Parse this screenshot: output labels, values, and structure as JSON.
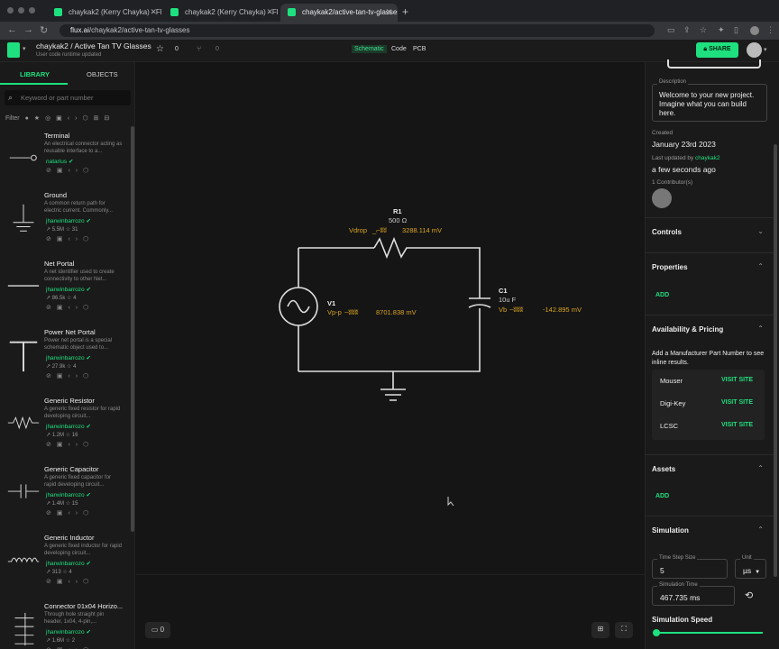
{
  "browser": {
    "tabs": [
      {
        "label": "chaykak2 (Kerry Chayka) - Flux"
      },
      {
        "label": "chaykak2 (Kerry Chayka) - Flux"
      },
      {
        "label": "chaykak2/active-tan-tv-glasses"
      }
    ],
    "url_host": "flux.ai",
    "url_path": "/chaykak2/active-tan-tv-glasses"
  },
  "header": {
    "title": "chaykak2 / Active Tan TV Glasses",
    "subtitle": "User code runtime updated",
    "star_count": "0",
    "fork_count": "0",
    "modes": [
      "Schematic",
      "Code",
      "PCB"
    ],
    "share_label": "SHARE"
  },
  "left": {
    "tabs": [
      "LIBRARY",
      "OBJECTS"
    ],
    "search_placeholder": "Keyword or part number",
    "filter_label": "Filter",
    "items": [
      {
        "title": "Terminal",
        "desc": "An electrical connector acting as reusable interface to a...",
        "author": "natarius",
        "stats": ""
      },
      {
        "title": "Ground",
        "desc": "A common return path for electric current. Commonly...",
        "author": "jharwinbarrozo",
        "stats": "5.5M  ☆ 31"
      },
      {
        "title": "Net Portal",
        "desc": "A net identifier used to create connectivity to other Net...",
        "author": "jharwinbarrozo",
        "stats": "86.5k  ☆ 4"
      },
      {
        "title": "Power Net Portal",
        "desc": "Power net portal is a special schematic object used to...",
        "author": "jharwinbarrozo",
        "stats": "27.9k  ☆ 4"
      },
      {
        "title": "Generic Resistor",
        "desc": "A generic fixed resistor for rapid developing circuit...",
        "author": "jharwinbarrozo",
        "stats": "1.2M  ☆ 16"
      },
      {
        "title": "Generic Capacitor",
        "desc": "A generic fixed capacitor for rapid developing circuit...",
        "author": "jharwinbarrozo",
        "stats": "1.4M  ☆ 15"
      },
      {
        "title": "Generic Inductor",
        "desc": "A generic fixed inductor for rapid developing circuit...",
        "author": "jharwinbarrozo",
        "stats": "313  ☆ 4"
      },
      {
        "title": "Connector 01x04 Horizo...",
        "desc": "Through hole straight pin header, 1x04, 4-pin,...",
        "author": "jharwinbarrozo",
        "stats": "1.6M  ☆ 2"
      }
    ]
  },
  "schematic": {
    "r1_name": "R1",
    "r1_value": "500 Ω",
    "r1_probe_label": "Vdrop",
    "r1_probe_value": "3288.114 mV",
    "v1_name": "V1",
    "v1_probe_label": "Vp-p",
    "v1_probe_value": "8701.838 mV",
    "c1_name": "C1",
    "c1_value": "10u F",
    "c1_probe_label": "Vb",
    "c1_probe_value": "-142.895 mV",
    "comment_count": "0"
  },
  "right": {
    "description_label": "Description",
    "description": "Welcome to your new project. Imagine what you can build here.",
    "created_label": "Created",
    "created_value": "January 23rd 2023",
    "updated_label": "Last updated by",
    "updated_user": "chaykak2",
    "updated_value": "a few seconds ago",
    "contributors_label": "1 Contributor(s)",
    "sections": {
      "controls": "Controls",
      "properties": "Properties",
      "availability": "Availability & Pricing",
      "assets": "Assets",
      "simulation": "Simulation"
    },
    "add_label": "ADD",
    "availability_text": "Add a Manufacturer Part Number to see inline results.",
    "suppliers": [
      {
        "name": "Mouser",
        "action": "VISIT SITE"
      },
      {
        "name": "Digi-Key",
        "action": "VISIT SITE"
      },
      {
        "name": "LCSC",
        "action": "VISIT SITE"
      }
    ],
    "time_step_label": "Time Step Size",
    "time_step_value": "5",
    "unit_label": "Unit",
    "unit_value": "µs",
    "sim_time_label": "Simulation Time",
    "sim_time_value": "467.735 ms",
    "sim_speed_label": "Simulation Speed"
  }
}
